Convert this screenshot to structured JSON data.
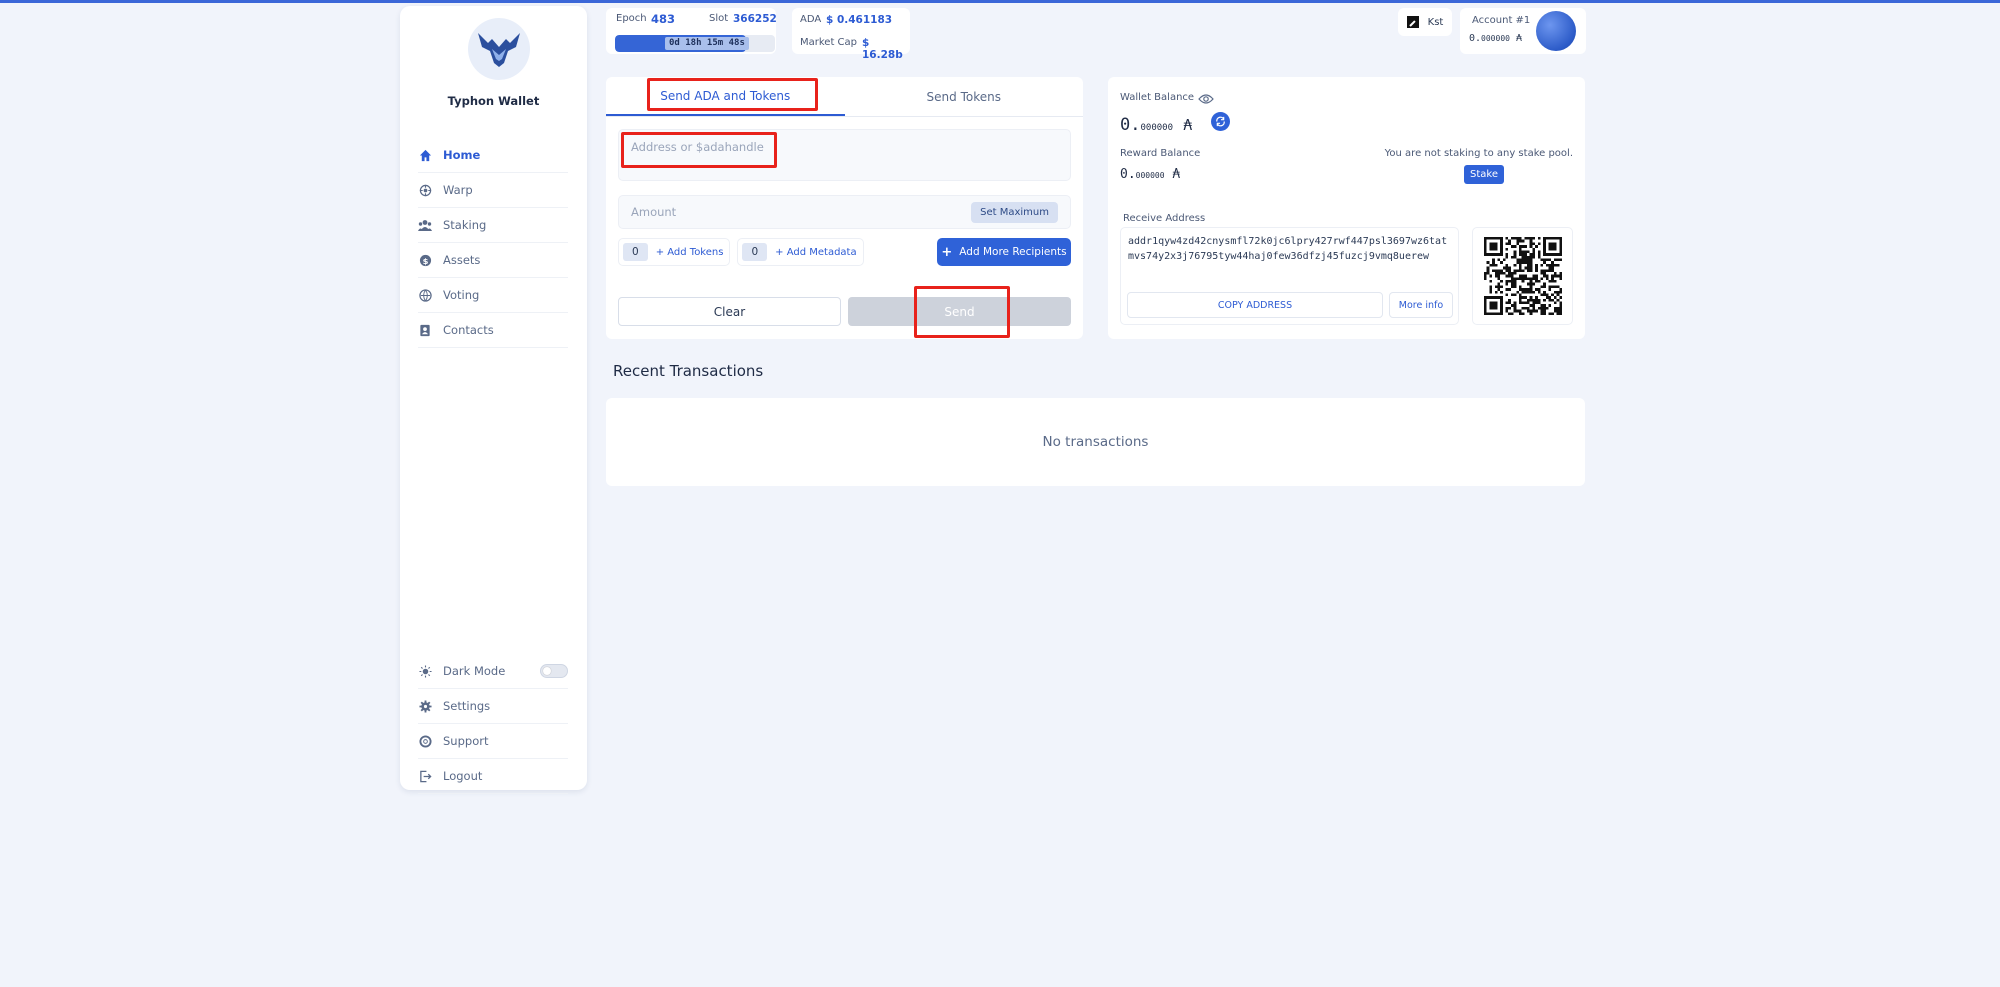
{
  "brand": {
    "name": "Typhon Wallet"
  },
  "nav": [
    {
      "label": "Home",
      "icon": "home-icon"
    },
    {
      "label": "Warp",
      "icon": "warp-icon"
    },
    {
      "label": "Staking",
      "icon": "staking-icon"
    },
    {
      "label": "Assets",
      "icon": "assets-icon"
    },
    {
      "label": "Voting",
      "icon": "voting-icon"
    },
    {
      "label": "Contacts",
      "icon": "contacts-icon"
    }
  ],
  "nav_bottom": {
    "dark_mode": "Dark Mode",
    "settings": "Settings",
    "support": "Support",
    "logout": "Logout"
  },
  "epoch": {
    "epoch_label": "Epoch",
    "epoch_value": "483",
    "slot_label": "Slot",
    "slot_value": "366252",
    "remaining": "0d 18h 15m 48s",
    "progress": 0.82
  },
  "market": {
    "ada_label": "ADA",
    "ada_value": "$ 0.461183",
    "cap_label": "Market Cap",
    "cap_value": "$ 16.28b"
  },
  "network": {
    "label": "Kst"
  },
  "account": {
    "name": "Account #1",
    "balance_int": "0.",
    "balance_dec": "000000",
    "currency": "₳"
  },
  "send": {
    "tab_ada": "Send ADA and Tokens",
    "tab_tokens": "Send Tokens",
    "address_placeholder": "Address or $adahandle",
    "amount_placeholder": "Amount",
    "set_max": "Set Maximum",
    "token_count": "0",
    "add_tokens": "+ Add Tokens",
    "metadata_count": "0",
    "add_metadata": "+ Add Metadata",
    "add_recipients": "Add More Recipients",
    "clear": "Clear",
    "send": "Send"
  },
  "wallet": {
    "balance_label": "Wallet Balance",
    "balance_int": "0.",
    "balance_dec": "000000",
    "currency": "₳",
    "reward_label": "Reward Balance",
    "reward_int": "0.",
    "reward_dec": "000000",
    "not_staking": "You are not staking to any stake pool.",
    "stake": "Stake",
    "receive_label": "Receive Address",
    "address": "addr1qyw4zd42cnysmfl72k0jc6lpry427rwf447psl3697wz6tatmvs74y2x3j76795tyw44haj0few36dfzj45fuzcj9vmq8uerew",
    "copy": "COPY ADDRESS",
    "more": "More info"
  },
  "recent": {
    "title": "Recent Transactions",
    "empty": "No transactions"
  },
  "colors": {
    "accent": "#2f62d8",
    "highlight": "#e8221b",
    "background": "#f1f4fb"
  }
}
